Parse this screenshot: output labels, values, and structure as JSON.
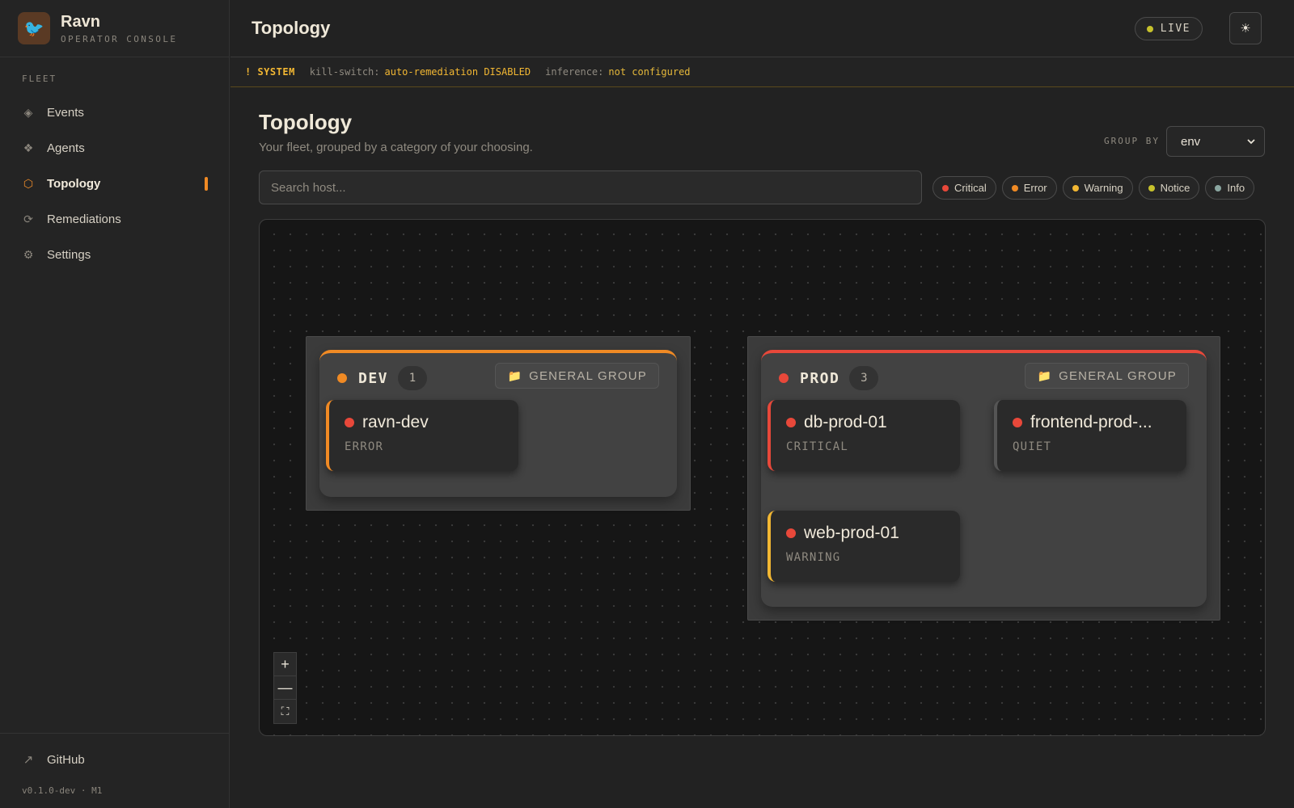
{
  "app": {
    "name": "Ravn",
    "subtitle": "OPERATOR CONSOLE",
    "logo_icon": "🐦"
  },
  "sidebar": {
    "section_label": "FLEET",
    "items": [
      {
        "label": "Events",
        "icon": "◈",
        "icon_name": "events-icon"
      },
      {
        "label": "Agents",
        "icon": "❖",
        "icon_name": "agents-icon"
      },
      {
        "label": "Topology",
        "icon": "⬡",
        "icon_name": "topology-icon",
        "active": true
      },
      {
        "label": "Remediations",
        "icon": "⟳",
        "icon_name": "remediations-icon"
      },
      {
        "label": "Settings",
        "icon": "⚙",
        "icon_name": "settings-icon"
      }
    ],
    "footer": {
      "github_label": "GitHub",
      "github_icon": "↗",
      "version": "v0.1.0-dev · M1"
    }
  },
  "header": {
    "title": "Topology",
    "live_label": "LIVE",
    "theme_icon": "☀"
  },
  "banner": {
    "label": "! SYSTEM",
    "killswitch_key": "kill-switch:",
    "killswitch_value": "auto-remediation DISABLED",
    "inference_key": "inference:",
    "inference_value": "not configured"
  },
  "main": {
    "title": "Topology",
    "subtitle": "Your fleet, grouped by a category of your choosing.",
    "group_by_label": "GROUP BY",
    "group_by_value": "env",
    "search_placeholder": "Search host...",
    "filters": [
      {
        "label": "Critical",
        "color": "#e8483a"
      },
      {
        "label": "Error",
        "color": "#f08a24"
      },
      {
        "label": "Warning",
        "color": "#f2b733"
      },
      {
        "label": "Notice",
        "color": "#c7c22c"
      },
      {
        "label": "Info",
        "color": "#8aa6a0"
      }
    ]
  },
  "topology": {
    "groups": [
      {
        "name": "DEV",
        "count": "1",
        "color": "#f08a24",
        "tag": "GENERAL GROUP",
        "tag_icon": "📁",
        "hosts": [
          {
            "name": "ravn-dev",
            "status": "ERROR",
            "accent": "#f08a24"
          }
        ]
      },
      {
        "name": "PROD",
        "count": "3",
        "color": "#e8483a",
        "tag": "GENERAL GROUP",
        "tag_icon": "📁",
        "hosts": [
          {
            "name": "db-prod-01",
            "status": "CRITICAL",
            "accent": "#e8483a"
          },
          {
            "name": "frontend-prod-...",
            "status": "QUIET",
            "accent": "#555555"
          },
          {
            "name": "web-prod-01",
            "status": "WARNING",
            "accent": "#f2b733"
          }
        ]
      }
    ],
    "zoom_controls": {
      "zoom_in": "+",
      "zoom_out": "—",
      "fit": "⛶"
    }
  }
}
